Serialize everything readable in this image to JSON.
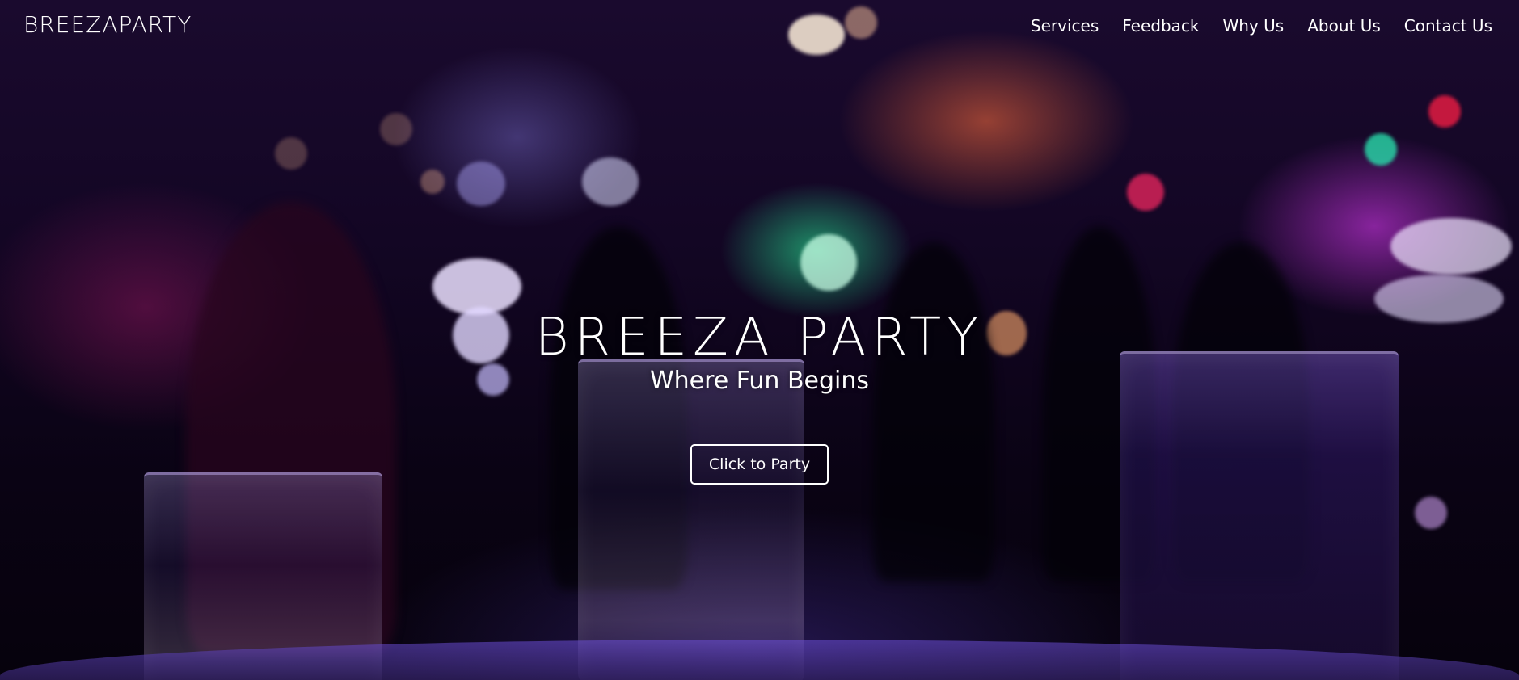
{
  "brand": {
    "name": "BREEZAPARTY"
  },
  "nav": {
    "items": [
      {
        "label": "Services"
      },
      {
        "label": "Feedback"
      },
      {
        "label": "Why Us"
      },
      {
        "label": "About Us"
      },
      {
        "label": "Contact Us"
      }
    ]
  },
  "hero": {
    "title": "BREEZA PARTY",
    "subtitle": "Where Fun Begins",
    "cta_label": "Click to Party",
    "background": "blurred-party-photo"
  },
  "colors": {
    "text": "#ffffff",
    "background_dark": "#0a0314",
    "accent_purple": "#7a3cff",
    "accent_green": "#28ffa0",
    "accent_magenta": "#e63cff",
    "accent_orange": "#ff6e3c"
  }
}
